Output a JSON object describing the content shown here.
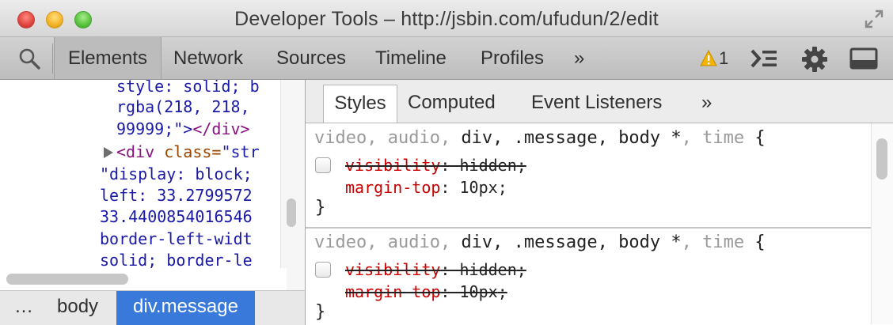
{
  "window": {
    "title": "Developer Tools – http://jsbin.com/ufudun/2/edit"
  },
  "toolbar": {
    "tabs": [
      "Elements",
      "Network",
      "Sources",
      "Timeline",
      "Profiles"
    ],
    "more": "»",
    "active_tab": "Elements",
    "warning_count": "1"
  },
  "dom_tree": {
    "lines": [
      "style: solid; b",
      "rgba(218, 218,",
      "99999;\">"
    ],
    "close_tag": "</div>",
    "element": {
      "open": "<div",
      "attr": " class=",
      "value": "\"str"
    },
    "style_lines": [
      "\"display: block;",
      "left: 33.2799572",
      "33.4400854016546",
      "border-left-widt",
      "solid; border-le"
    ]
  },
  "breadcrumb": {
    "items": [
      "…",
      "body",
      "div.message"
    ],
    "active": "div.message"
  },
  "styles_panel": {
    "tabs": [
      "Styles",
      "Computed",
      "Event Listeners"
    ],
    "more": "»",
    "active_tab": "Styles",
    "rules": [
      {
        "selector_parts": [
          "video, audio, ",
          "div, .message, body *",
          ", time",
          " {"
        ],
        "properties": [
          {
            "name": "visibility",
            "value": "hidden",
            "overridden": true,
            "has_checkbox": true
          },
          {
            "name": "margin-top",
            "value": "10px",
            "overridden": false,
            "has_checkbox": false
          }
        ],
        "close": "}"
      },
      {
        "selector_parts": [
          "video, audio, ",
          "div, .message, body *",
          ", time",
          " {"
        ],
        "properties": [
          {
            "name": "visibility",
            "value": "hidden",
            "overridden": true,
            "has_checkbox": true
          },
          {
            "name": "margin-top",
            "value": "10px",
            "overridden": true,
            "has_checkbox": false
          }
        ],
        "close": "}"
      }
    ]
  },
  "colors": {
    "active_crumb": "#3879d9",
    "property_name": "#c80000",
    "tag": "#881280",
    "attribute": "#994500",
    "warning": "#f4b400"
  },
  "icons": [
    "search-icon",
    "warning-icon",
    "console-icon",
    "gear-icon",
    "dock-icon",
    "fullscreen-icon",
    "expand-triangle-icon"
  ]
}
